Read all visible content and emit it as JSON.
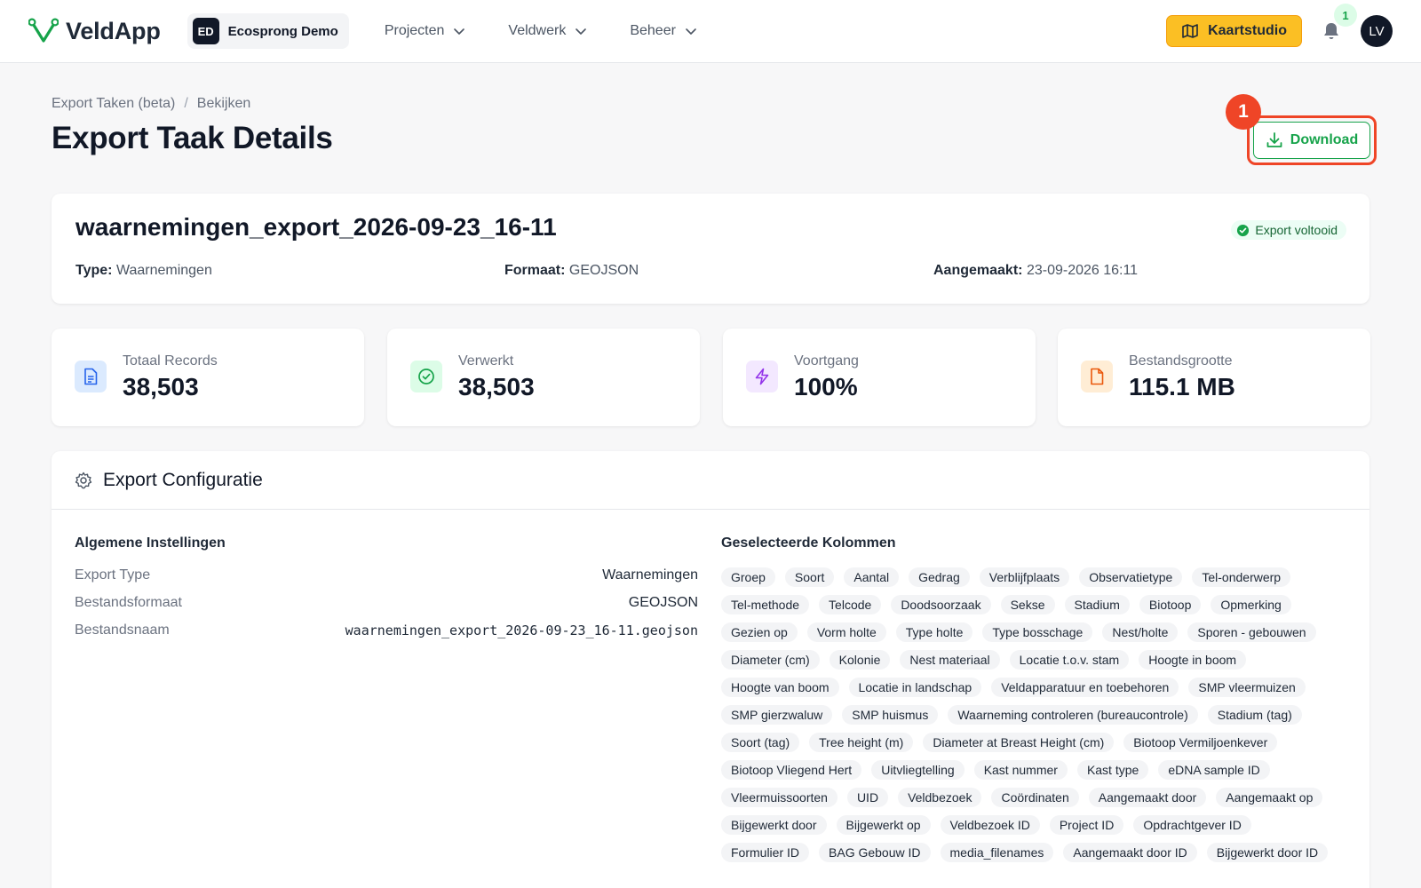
{
  "colors": {
    "accent": "#fbbf24",
    "success": "#16a34a",
    "highlight": "#ef4527"
  },
  "nav": {
    "logo_text": "VeldApp",
    "org_badge": "ED",
    "org_name": "Ecosprong Demo",
    "items": [
      {
        "label": "Projecten",
        "icon": "chevron-down-icon"
      },
      {
        "label": "Veldwerk",
        "icon": "chevron-down-icon"
      },
      {
        "label": "Beheer",
        "icon": "chevron-down-icon"
      }
    ],
    "kaartstudio_label": "Kaartstudio",
    "notification_count": "1",
    "avatar_initials": "LV"
  },
  "header": {
    "breadcrumb": [
      "Export Taken (beta)",
      "Bekijken"
    ],
    "title": "Export Taak Details",
    "download_label": "Download",
    "marker_label": "1"
  },
  "summary": {
    "file_name": "waarnemingen_export_2026-09-23_16-11",
    "status": "Export voltooid",
    "type_label": "Type:",
    "type_value": "Waarnemingen",
    "format_label": "Formaat:",
    "format_value": "GEOJSON",
    "created_label": "Aangemaakt:",
    "created_value": "23-09-2026 16:11"
  },
  "stats": [
    {
      "label": "Totaal Records",
      "value": "38,503",
      "icon": "document-icon"
    },
    {
      "label": "Verwerkt",
      "value": "38,503",
      "icon": "check-circle-icon"
    },
    {
      "label": "Voortgang",
      "value": "100%",
      "icon": "lightning-icon"
    },
    {
      "label": "Bestandsgrootte",
      "value": "115.1 MB",
      "icon": "file-icon"
    }
  ],
  "config": {
    "title": "Export Configuratie",
    "general": {
      "title": "Algemene Instellingen",
      "rows": [
        {
          "key": "Export Type",
          "value": "Waarnemingen"
        },
        {
          "key": "Bestandsformaat",
          "value": "GEOJSON"
        },
        {
          "key": "Bestandsnaam",
          "value": "waarnemingen_export_2026-09-23_16-11.geojson"
        }
      ]
    },
    "columns_title": "Geselecteerde Kolommen",
    "columns": [
      "Groep",
      "Soort",
      "Aantal",
      "Gedrag",
      "Verblijfplaats",
      "Observatietype",
      "Tel-onderwerp",
      "Tel-methode",
      "Telcode",
      "Doodsoorzaak",
      "Sekse",
      "Stadium",
      "Biotoop",
      "Opmerking",
      "Gezien op",
      "Vorm holte",
      "Type holte",
      "Type bosschage",
      "Nest/holte",
      "Sporen - gebouwen",
      "Diameter (cm)",
      "Kolonie",
      "Nest materiaal",
      "Locatie t.o.v. stam",
      "Hoogte in boom",
      "Hoogte van boom",
      "Locatie in landschap",
      "Veldapparatuur en toebehoren",
      "SMP vleermuizen",
      "SMP gierzwaluw",
      "SMP huismus",
      "Waarneming controleren (bureaucontrole)",
      "Stadium (tag)",
      "Soort (tag)",
      "Tree height (m)",
      "Diameter at Breast Height (cm)",
      "Biotoop Vermiljoenkever",
      "Biotoop Vliegend Hert",
      "Uitvliegtelling",
      "Kast nummer",
      "Kast type",
      "eDNA sample ID",
      "Vleermuissoorten",
      "UID",
      "Veldbezoek",
      "Coördinaten",
      "Aangemaakt door",
      "Aangemaakt op",
      "Bijgewerkt door",
      "Bijgewerkt op",
      "Veldbezoek ID",
      "Project ID",
      "Opdrachtgever ID",
      "Formulier ID",
      "BAG Gebouw ID",
      "media_filenames",
      "Aangemaakt door ID",
      "Bijgewerkt door ID"
    ]
  }
}
